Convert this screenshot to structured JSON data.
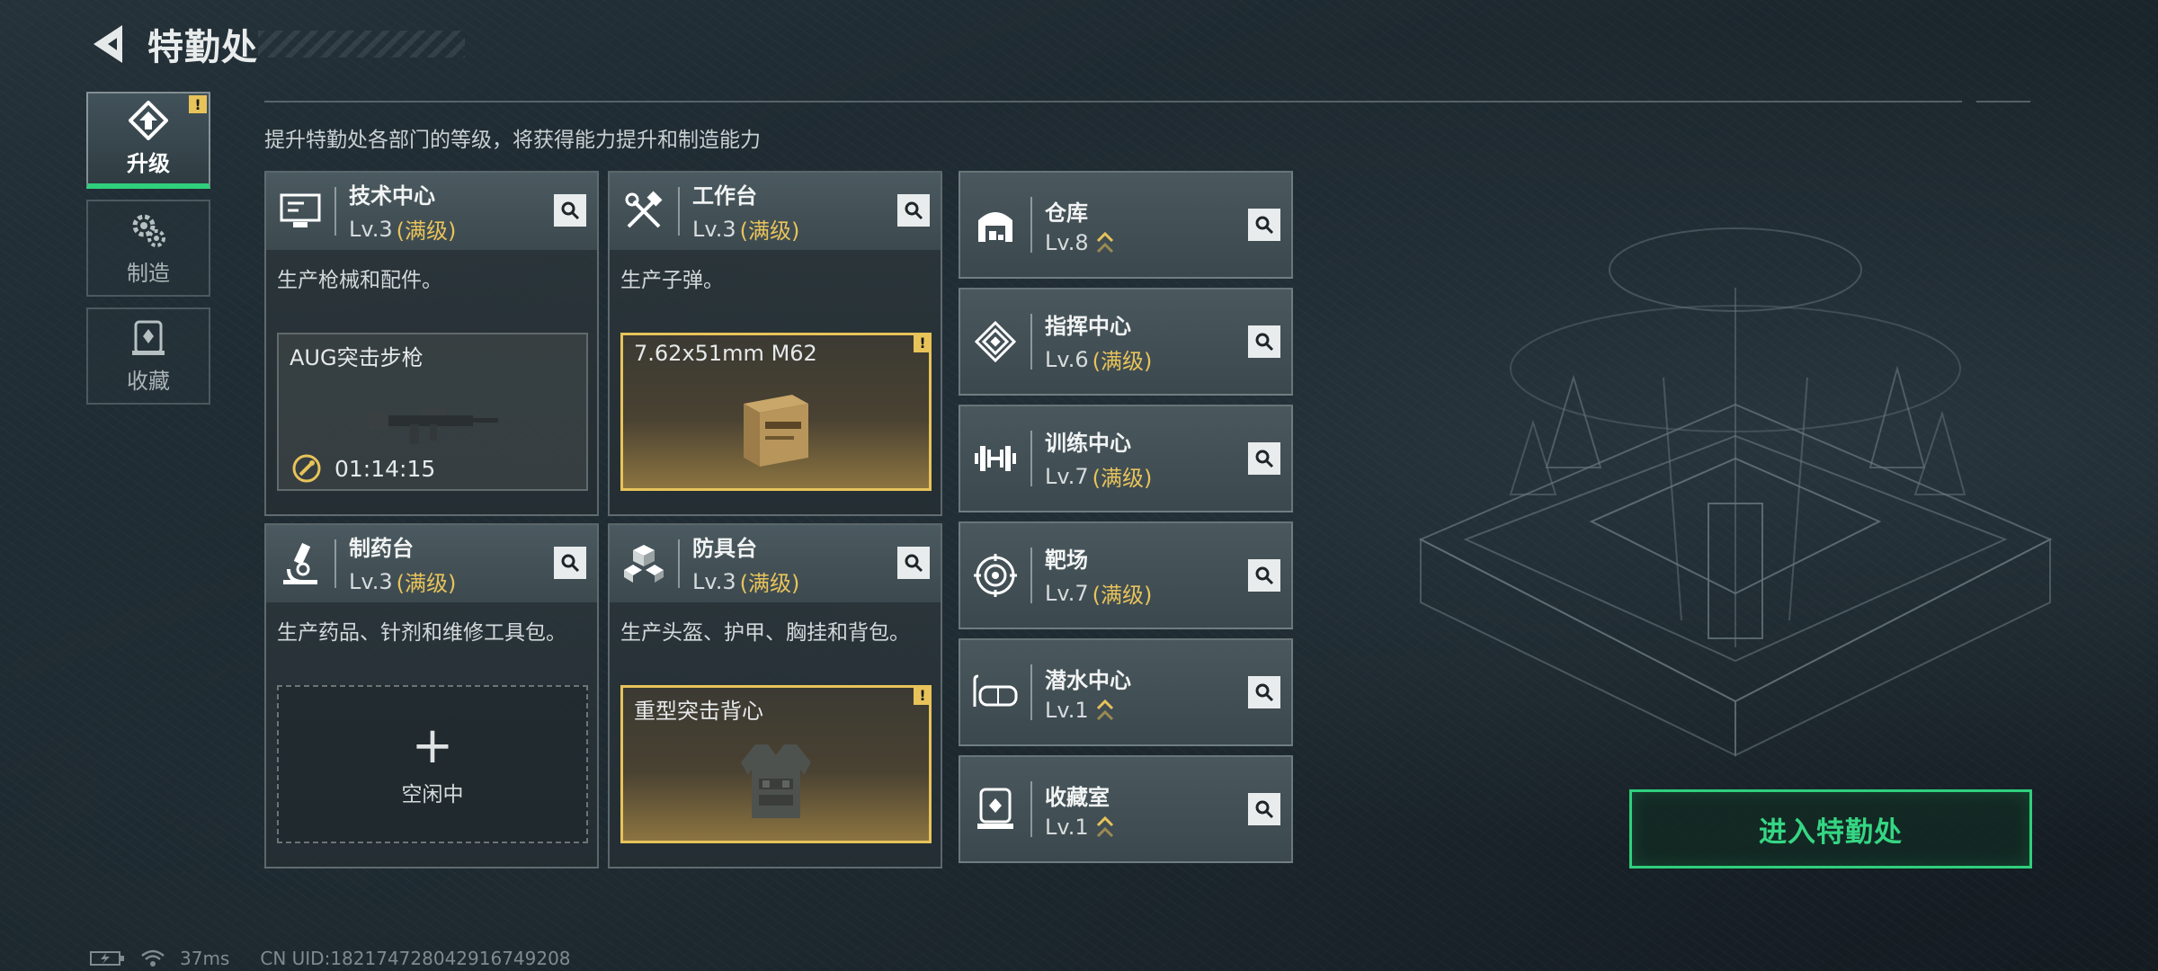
{
  "header": {
    "title": "特勤处"
  },
  "sidenav": [
    {
      "label": "升级",
      "icon": "upgrade-icon",
      "active": true,
      "alert": "!"
    },
    {
      "label": "制造",
      "icon": "gears-icon",
      "active": false
    },
    {
      "label": "收藏",
      "icon": "collection-icon",
      "active": false
    }
  ],
  "description": "提升特勤处各部门的等级，将获得能力提升和制造能力",
  "depts": [
    {
      "name": "技术中心",
      "level": "Lv.3",
      "max": "(满级)",
      "desc": "生产枪械和配件。",
      "slot": {
        "label": "AUG突击步枪",
        "timer": "01:14:15"
      }
    },
    {
      "name": "工作台",
      "level": "Lv.3",
      "max": "(满级)",
      "desc": "生产子弹。",
      "slot": {
        "label": "7.62x51mm M62",
        "alert": "!"
      }
    },
    {
      "name": "制药台",
      "level": "Lv.3",
      "max": "(满级)",
      "desc": "生产药品、针剂和维修工具包。",
      "slot": {
        "plus": "+",
        "idle": "空闲中"
      }
    },
    {
      "name": "防具台",
      "level": "Lv.3",
      "max": "(满级)",
      "desc": "生产头盔、护甲、胸挂和背包。",
      "slot": {
        "label": "重型突击背心",
        "alert": "!"
      }
    }
  ],
  "facilities": [
    {
      "name": "仓库",
      "level": "Lv.8",
      "max": ""
    },
    {
      "name": "指挥中心",
      "level": "Lv.6",
      "max": "(满级)"
    },
    {
      "name": "训练中心",
      "level": "Lv.7",
      "max": "(满级)"
    },
    {
      "name": "靶场",
      "level": "Lv.7",
      "max": "(满级)"
    },
    {
      "name": "潜水中心",
      "level": "Lv.1",
      "max": ""
    },
    {
      "name": "收藏室",
      "level": "Lv.1",
      "max": ""
    }
  ],
  "enter_button": "进入特勤处",
  "status": {
    "ping": "37ms",
    "uid": "CN UID:182174728042916749208"
  },
  "colors": {
    "accent_green": "#2fd07c",
    "gold": "#e8c35a"
  }
}
